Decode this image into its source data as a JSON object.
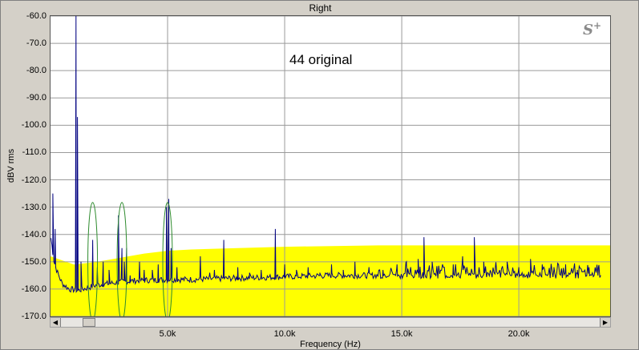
{
  "chart_data": {
    "type": "line",
    "title": "Right",
    "xlabel": "Frequency (Hz)",
    "ylabel": "dBV rms",
    "xlim": [
      0,
      23900
    ],
    "ylim": [
      -170,
      -60
    ],
    "x_ticks": [
      5000,
      10000,
      15000,
      20000
    ],
    "x_tick_labels": [
      "5.0k",
      "10.0k",
      "15.0k",
      "20.0k"
    ],
    "y_ticks": [
      -60,
      -70,
      -80,
      -90,
      -100,
      -110,
      -120,
      -130,
      -140,
      -150,
      -160,
      -170
    ],
    "y_tick_labels": [
      "-60.0",
      "-70.0",
      "-80.0",
      "-90.0",
      "-100.0",
      "-110.0",
      "-120.0",
      "-130.0",
      "-140.0",
      "-150.0",
      "-160.0",
      "-170.0"
    ],
    "annotation": "44 original",
    "grid": true,
    "fill_color": "#ffff00",
    "line_color": "#000080",
    "circle_color": "#2e8b2e",
    "noise_band": {
      "lower": -170,
      "upper_x": [
        0,
        1000,
        2000,
        3000,
        4000,
        5000,
        6000,
        8000,
        10000,
        14000,
        18000,
        23900
      ],
      "upper_y": [
        -148,
        -151,
        -150,
        -148.5,
        -147,
        -146,
        -145.5,
        -145,
        -144.5,
        -144,
        -144,
        -144
      ]
    },
    "baseline": {
      "x": [
        0,
        150,
        300,
        500,
        800,
        1200,
        1600,
        2000,
        2500,
        3000,
        3500,
        4000,
        5000,
        6000,
        8000,
        10000,
        12000,
        15000,
        18000,
        20000,
        23500
      ],
      "y": [
        -140,
        -150,
        -154,
        -158,
        -160,
        -160.5,
        -159.5,
        -158.5,
        -158,
        -157.5,
        -157,
        -156.8,
        -156.5,
        -156.5,
        -156,
        -155.5,
        -155,
        -155,
        -155,
        -155,
        -155
      ]
    },
    "peaks": {
      "x": [
        100,
        200,
        1090,
        1150,
        1300,
        1800,
        2000,
        2250,
        2500,
        2900,
        3050,
        3150,
        3250,
        3400,
        3800,
        4000,
        4350,
        4600,
        4950,
        5050,
        5150,
        5400,
        6400,
        6800,
        7000,
        7400,
        8000,
        8500,
        9000,
        9600,
        10000,
        10500,
        11000,
        11500,
        12000,
        12500,
        13000,
        13600,
        14200,
        14800,
        15200,
        15700,
        15950,
        16300,
        16800,
        17200,
        17600,
        18100,
        18500,
        19000,
        19500,
        20000,
        20500,
        21000,
        21500,
        22000,
        22500,
        23000,
        23400
      ],
      "y": [
        -125,
        -138,
        -60,
        -97,
        -150,
        -142,
        -152,
        -150,
        -153,
        -133,
        -145,
        -150,
        -145,
        -155,
        -150,
        -153,
        -153,
        -151,
        -130,
        -127,
        -145,
        -152,
        -148,
        -154,
        -153,
        -142,
        -152,
        -154,
        -153,
        -138,
        -151,
        -153,
        -152,
        -154,
        -151,
        -153,
        -150,
        -152,
        -153,
        -151,
        -150,
        -149,
        -141,
        -150,
        -152,
        -151,
        -148,
        -141,
        -150,
        -152,
        -150,
        -152,
        -149,
        -151,
        -152,
        -151,
        -153,
        -152,
        -152
      ]
    },
    "highlight_circles_x": [
      1800,
      3050,
      5000
    ]
  }
}
